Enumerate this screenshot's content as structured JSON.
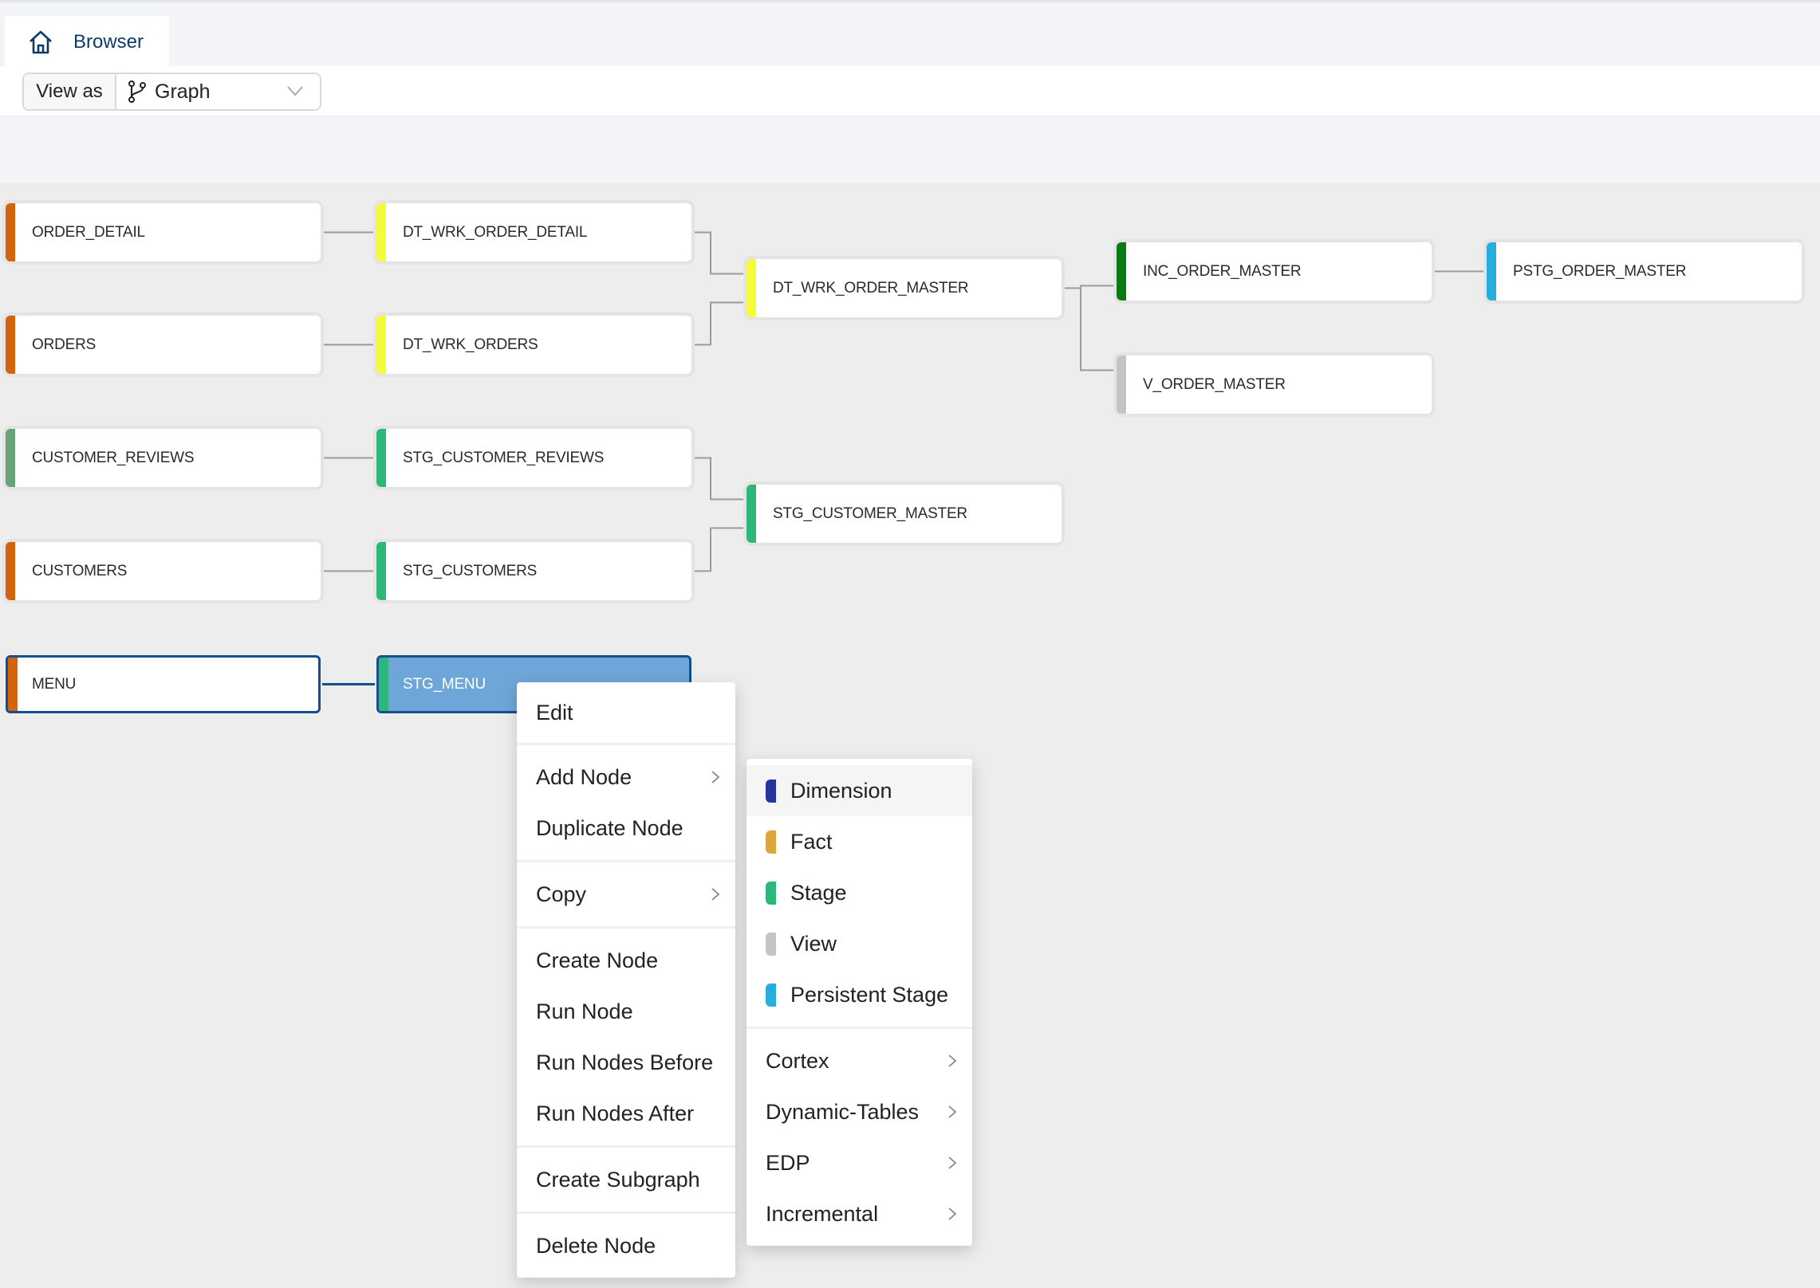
{
  "tab": {
    "label": "Browser",
    "icon": "home-icon"
  },
  "toolbar": {
    "view_as_label": "View as",
    "view_mode": "Graph",
    "view_mode_icon": "branch-graph-icon"
  },
  "colors": {
    "source": "#d4630a",
    "dynamic_table": "#f4fb3b",
    "stage": "#2db87a",
    "incremental": "#0a7a14",
    "persistent_stage": "#27aedc",
    "view": "#c4c4c4",
    "source_alt": "#6aa37a",
    "dimension": "#23359c",
    "fact": "#dca63a",
    "selection_border": "#14508f",
    "active_fill": "#6fa6d9"
  },
  "graph": {
    "nodes": [
      {
        "id": "order_detail",
        "label": "ORDER_DETAIL",
        "type": "source"
      },
      {
        "id": "orders",
        "label": "ORDERS",
        "type": "source"
      },
      {
        "id": "customer_reviews",
        "label": "CUSTOMER_REVIEWS",
        "type": "source_alt"
      },
      {
        "id": "customers",
        "label": "CUSTOMERS",
        "type": "source"
      },
      {
        "id": "menu",
        "label": "MENU",
        "type": "source",
        "state": "selected"
      },
      {
        "id": "dt_wrk_order_detail",
        "label": "DT_WRK_ORDER_DETAIL",
        "type": "dynamic_table"
      },
      {
        "id": "dt_wrk_orders",
        "label": "DT_WRK_ORDERS",
        "type": "dynamic_table"
      },
      {
        "id": "stg_customer_reviews",
        "label": "STG_CUSTOMER_REVIEWS",
        "type": "stage"
      },
      {
        "id": "stg_customers",
        "label": "STG_CUSTOMERS",
        "type": "stage"
      },
      {
        "id": "stg_menu",
        "label": "STG_MENU",
        "type": "stage",
        "state": "active"
      },
      {
        "id": "dt_wrk_order_master",
        "label": "DT_WRK_ORDER_MASTER",
        "type": "dynamic_table"
      },
      {
        "id": "stg_customer_master",
        "label": "STG_CUSTOMER_MASTER",
        "type": "stage"
      },
      {
        "id": "inc_order_master",
        "label": "INC_ORDER_MASTER",
        "type": "incremental"
      },
      {
        "id": "v_order_master",
        "label": "V_ORDER_MASTER",
        "type": "view"
      },
      {
        "id": "pstg_order_master",
        "label": "PSTG_ORDER_MASTER",
        "type": "persistent_stage"
      }
    ],
    "edges": [
      [
        "order_detail",
        "dt_wrk_order_detail"
      ],
      [
        "orders",
        "dt_wrk_orders"
      ],
      [
        "customer_reviews",
        "stg_customer_reviews"
      ],
      [
        "customers",
        "stg_customers"
      ],
      [
        "menu",
        "stg_menu"
      ],
      [
        "dt_wrk_order_detail",
        "dt_wrk_order_master"
      ],
      [
        "dt_wrk_orders",
        "dt_wrk_order_master"
      ],
      [
        "stg_customer_reviews",
        "stg_customer_master"
      ],
      [
        "stg_customers",
        "stg_customer_master"
      ],
      [
        "dt_wrk_order_master",
        "inc_order_master"
      ],
      [
        "dt_wrk_order_master",
        "v_order_master"
      ],
      [
        "inc_order_master",
        "pstg_order_master"
      ]
    ]
  },
  "context_menu": {
    "groups": [
      [
        {
          "label": "Edit"
        }
      ],
      [
        {
          "label": "Add Node",
          "submenu": true
        },
        {
          "label": "Duplicate Node"
        }
      ],
      [
        {
          "label": "Copy",
          "submenu": true
        }
      ],
      [
        {
          "label": "Create Node"
        },
        {
          "label": "Run Node"
        },
        {
          "label": "Run Nodes Before"
        },
        {
          "label": "Run Nodes After"
        }
      ],
      [
        {
          "label": "Create Subgraph"
        }
      ],
      [
        {
          "label": "Delete Node"
        }
      ]
    ]
  },
  "add_node_submenu": {
    "node_types": [
      {
        "label": "Dimension",
        "color": "#23359c",
        "hovered": true
      },
      {
        "label": "Fact",
        "color": "#dca63a"
      },
      {
        "label": "Stage",
        "color": "#2db87a"
      },
      {
        "label": "View",
        "color": "#c4c4c4"
      },
      {
        "label": "Persistent Stage",
        "color": "#27aedc"
      }
    ],
    "packages": [
      {
        "label": "Cortex",
        "submenu": true
      },
      {
        "label": "Dynamic-Tables",
        "submenu": true
      },
      {
        "label": "EDP",
        "submenu": true
      },
      {
        "label": "Incremental",
        "submenu": true
      }
    ]
  }
}
